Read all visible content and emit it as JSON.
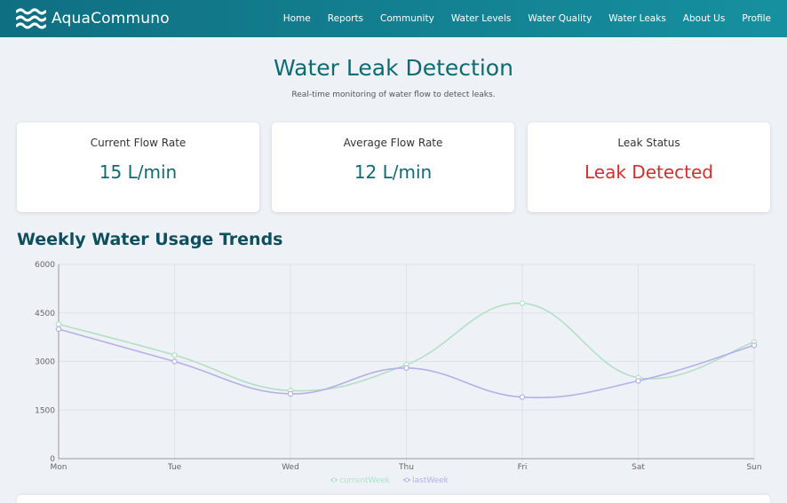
{
  "brand": {
    "name": "AquaCommuno"
  },
  "nav": {
    "items": [
      {
        "label": "Home"
      },
      {
        "label": "Reports"
      },
      {
        "label": "Community"
      },
      {
        "label": "Water Levels"
      },
      {
        "label": "Water Quality"
      },
      {
        "label": "Water Leaks"
      },
      {
        "label": "About Us"
      },
      {
        "label": "Profile"
      }
    ]
  },
  "header": {
    "title": "Water Leak Detection",
    "subtitle": "Real-time monitoring of water flow to detect leaks."
  },
  "cards": {
    "current": {
      "label": "Current Flow Rate",
      "value": "15 L/min"
    },
    "average": {
      "label": "Average Flow Rate",
      "value": "12 L/min"
    },
    "leak": {
      "label": "Leak Status",
      "value": "Leak Detected",
      "color": "#d32f2f"
    }
  },
  "section": {
    "title": "Weekly Water Usage Trends"
  },
  "colors": {
    "navbar": "#12808f",
    "accent": "#0f6a72",
    "alert": "#d32f2f"
  },
  "chart_data": {
    "type": "line",
    "categories": [
      "Mon",
      "Tue",
      "Wed",
      "Thu",
      "Fri",
      "Sat",
      "Sun"
    ],
    "series": [
      {
        "name": "currentWeek",
        "values": [
          4150,
          3200,
          2100,
          2900,
          4800,
          2500,
          3600
        ],
        "color": "#b3e0c4"
      },
      {
        "name": "lastWeek",
        "values": [
          4000,
          3000,
          2000,
          2800,
          1900,
          2400,
          3500
        ],
        "color": "#b4b0e8"
      }
    ],
    "yticks": [
      "0",
      "1500",
      "3000",
      "4500",
      "6000"
    ],
    "ylim": [
      0,
      6000
    ],
    "grid": true,
    "legend": "bottom",
    "smooth": true
  }
}
